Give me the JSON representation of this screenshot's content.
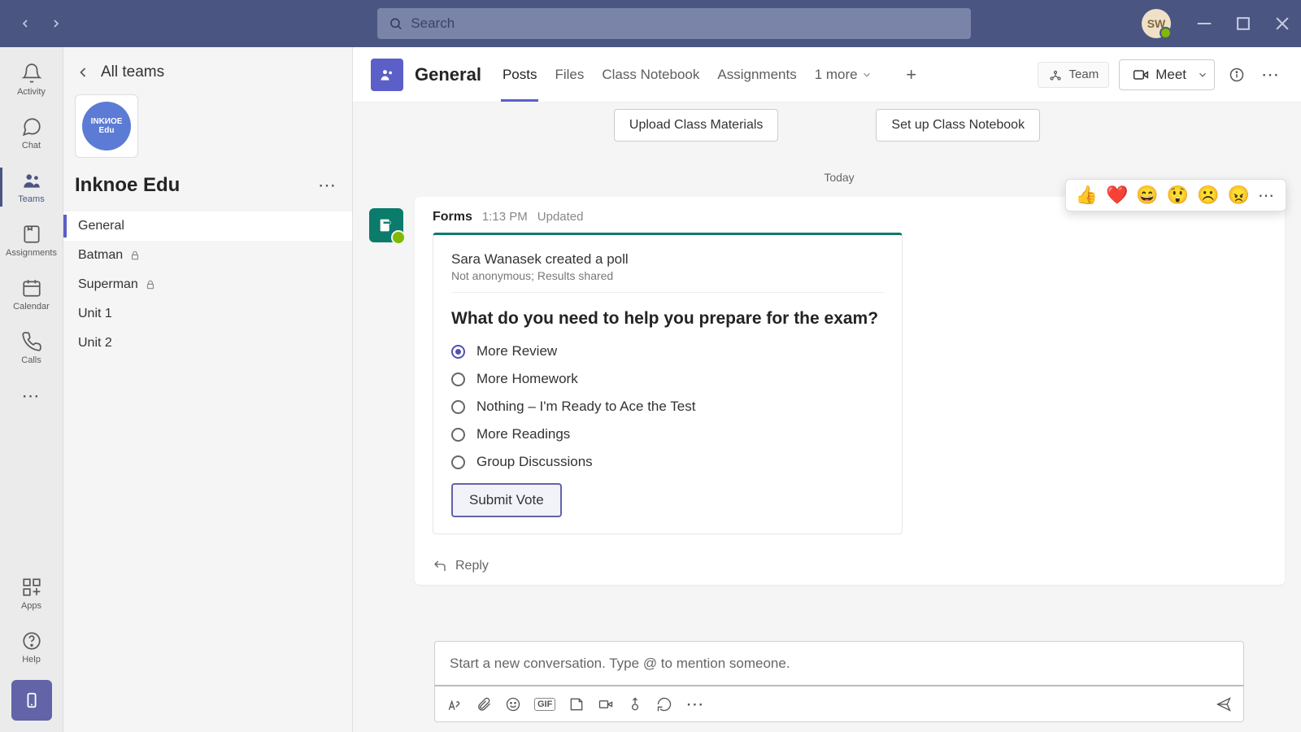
{
  "search": {
    "placeholder": "Search"
  },
  "user_avatar": "SW",
  "rail": {
    "items": [
      {
        "id": "activity",
        "label": "Activity"
      },
      {
        "id": "chat",
        "label": "Chat"
      },
      {
        "id": "teams",
        "label": "Teams"
      },
      {
        "id": "assignments",
        "label": "Assignments"
      },
      {
        "id": "calendar",
        "label": "Calendar"
      },
      {
        "id": "calls",
        "label": "Calls"
      }
    ],
    "apps": "Apps",
    "help": "Help"
  },
  "sidebar": {
    "back": "All teams",
    "team_logo_top": "INKИOE",
    "team_logo_bottom": "Edu",
    "team": "Inknoe Edu",
    "channels": [
      {
        "name": "General",
        "locked": false,
        "active": true
      },
      {
        "name": "Batman",
        "locked": true
      },
      {
        "name": "Superman",
        "locked": true
      },
      {
        "name": "Unit 1",
        "locked": false
      },
      {
        "name": "Unit 2",
        "locked": false
      }
    ]
  },
  "header": {
    "avatar_initial": "G",
    "title": "General",
    "tabs": [
      "Posts",
      "Files",
      "Class Notebook",
      "Assignments"
    ],
    "more": "1 more",
    "team_btn": "Team",
    "meet": "Meet"
  },
  "actions": {
    "upload": "Upload Class Materials",
    "notebook": "Set up Class Notebook"
  },
  "day": "Today",
  "message": {
    "app": "Forms",
    "time": "1:13 PM",
    "status": "Updated",
    "poll": {
      "creator": "Sara Wanasek created a poll",
      "sub": "Not anonymous; Results shared",
      "question": "What do you need to help you prepare for the exam?",
      "options": [
        "More Review",
        "More Homework",
        "Nothing – I'm Ready to Ace the Test",
        "More Readings",
        "Group Discussions"
      ],
      "selected": 0,
      "submit": "Submit Vote"
    },
    "reply": "Reply"
  },
  "reactions": [
    "👍",
    "❤️",
    "😄",
    "😲",
    "☹️",
    "😠"
  ],
  "composer": {
    "placeholder": "Start a new conversation. Type @ to mention someone.",
    "gif": "GIF"
  }
}
